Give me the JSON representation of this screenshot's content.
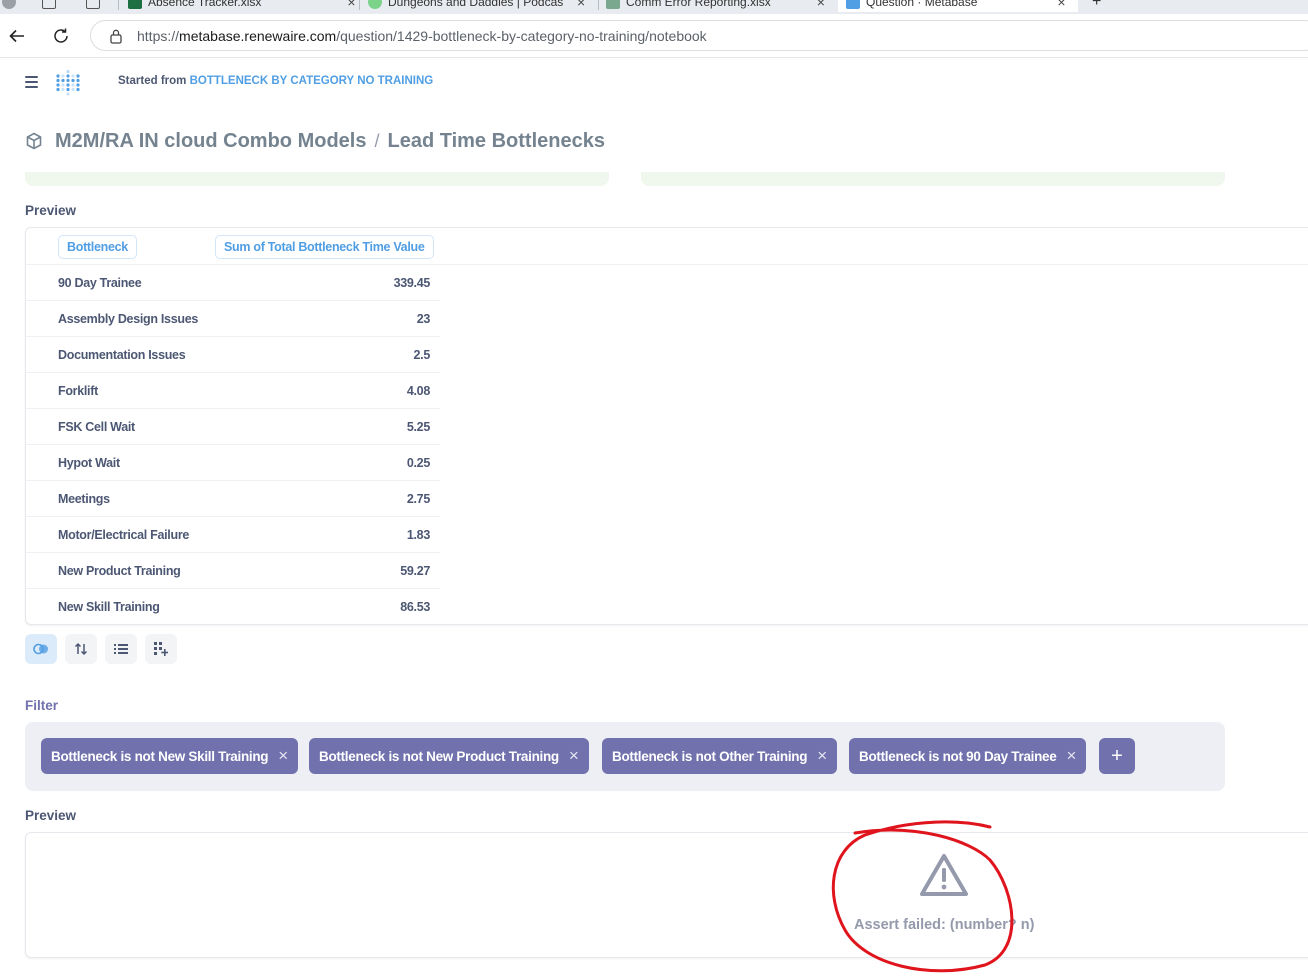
{
  "browser": {
    "tabs": [
      {
        "title": "Absence Tracker.xlsx",
        "icon": "excel-icon",
        "color": "#1d6f42"
      },
      {
        "title": "Dungeons and Daddies | Podcast",
        "icon": "podcast-icon",
        "color": "#7bd38a"
      },
      {
        "title": "Comm Error Reporting.xlsx",
        "icon": "excel-icon",
        "color": "#7aa88f"
      },
      {
        "title": "Question · Metabase",
        "icon": "metabase-icon",
        "color": "#509ee3"
      }
    ],
    "url_scheme": "https://",
    "url_host": "metabase.renewaire.com",
    "url_path": "/question/1429-bottleneck-by-category-no-training/notebook"
  },
  "header": {
    "started_from_label": "Started from",
    "started_from_link": "BOTTLENECK BY CATEGORY NO TRAINING"
  },
  "breadcrumb": {
    "collection": "M2M/RA IN cloud Combo Models",
    "separator": "/",
    "question": "Lead Time Bottlenecks"
  },
  "preview1": {
    "label": "Preview",
    "columns": [
      "Bottleneck",
      "Sum of Total Bottleneck Time Value"
    ],
    "rows": [
      [
        "90 Day Trainee",
        "339.45"
      ],
      [
        "Assembly Design Issues",
        "23"
      ],
      [
        "Documentation Issues",
        "2.5"
      ],
      [
        "Forklift",
        "4.08"
      ],
      [
        "FSK Cell Wait",
        "5.25"
      ],
      [
        "Hypot Wait",
        "0.25"
      ],
      [
        "Meetings",
        "2.75"
      ],
      [
        "Motor/Electrical Failure",
        "1.83"
      ],
      [
        "New Product Training",
        "59.27"
      ],
      [
        "New Skill Training",
        "86.53"
      ]
    ]
  },
  "filter": {
    "label": "Filter",
    "chips": [
      "Bottleneck is not New Skill Training",
      "Bottleneck is not New Product Training",
      "Bottleneck is not Other Training",
      "Bottleneck is not 90 Day Trainee"
    ],
    "add_label": "+"
  },
  "preview2": {
    "label": "Preview",
    "error": "Assert failed: (number? n)"
  },
  "colors": {
    "brand": "#509ee3",
    "filter_chip": "#7172ad",
    "annotation": "#e0141c"
  }
}
